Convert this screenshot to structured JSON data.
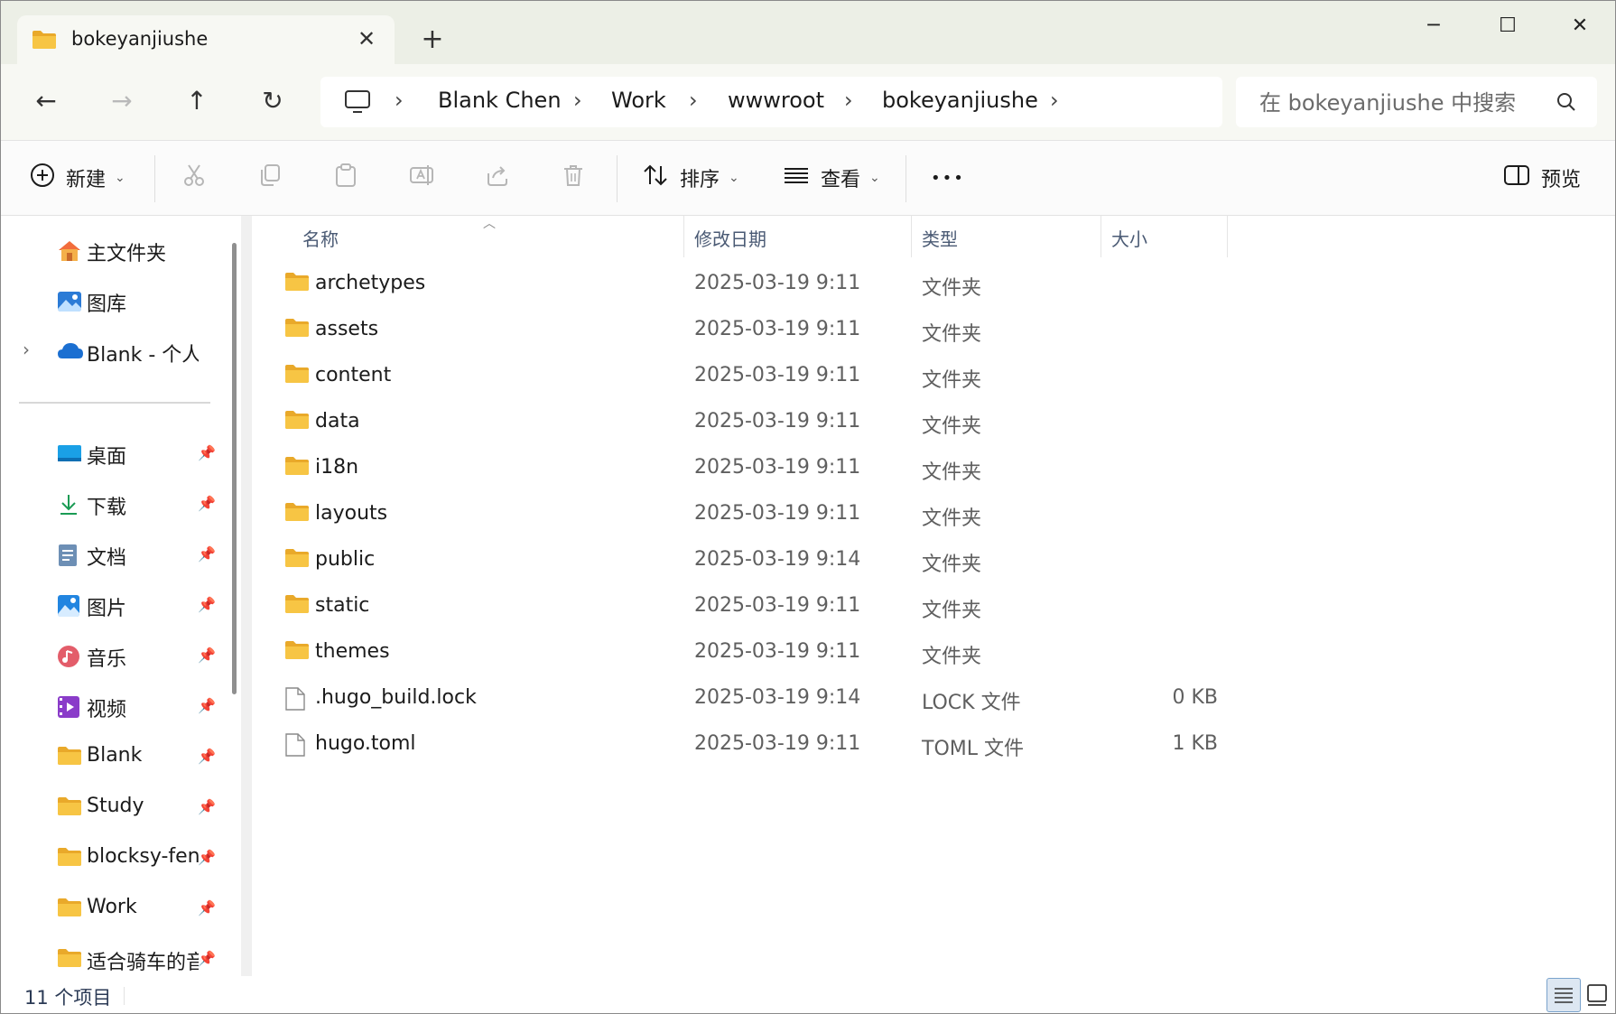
{
  "titlebar": {
    "tab_title": "bokeyanjiushe",
    "tab_close": "✕",
    "new_tab": "+",
    "minimize": "─",
    "maximize": "☐",
    "close": "✕"
  },
  "nav": {
    "back": "←",
    "forward": "→",
    "up": "↑",
    "refresh": "↻"
  },
  "address": {
    "separator": "›",
    "crumbs": [
      "Blank Chen",
      "Work",
      "wwwroot",
      "bokeyanjiushe"
    ]
  },
  "search": {
    "placeholder": "在 bokeyanjiushe 中搜索"
  },
  "commandbar": {
    "new_label": "新建",
    "sort_label": "排序",
    "view_label": "查看",
    "more_label": "•••",
    "preview_label": "预览"
  },
  "sidebar": {
    "top_items": [
      {
        "label": "主文件夹",
        "icon": "home-icon"
      },
      {
        "label": "图库",
        "icon": "gallery-icon"
      },
      {
        "label": "Blank - 个人",
        "icon": "onedrive-cloud-icon",
        "expand": "›"
      }
    ],
    "pinned_items": [
      {
        "label": "桌面",
        "icon": "desktop-icon"
      },
      {
        "label": "下载",
        "icon": "download-icon"
      },
      {
        "label": "文档",
        "icon": "documents-icon"
      },
      {
        "label": "图片",
        "icon": "pictures-icon"
      },
      {
        "label": "音乐",
        "icon": "music-icon"
      },
      {
        "label": "视频",
        "icon": "videos-icon"
      },
      {
        "label": "Blank",
        "icon": "folder-icon"
      },
      {
        "label": "Study",
        "icon": "folder-icon"
      },
      {
        "label": "blocksy-feng",
        "icon": "folder-icon"
      },
      {
        "label": "Work",
        "icon": "folder-icon"
      },
      {
        "label": "适合骑车的音",
        "icon": "folder-icon"
      }
    ]
  },
  "columns": {
    "name": "名称",
    "modified": "修改日期",
    "type": "类型",
    "size": "大小"
  },
  "files": [
    {
      "name": "archetypes",
      "date": "2025-03-19 9:11",
      "type": "文件夹",
      "size": "",
      "kind": "folder"
    },
    {
      "name": "assets",
      "date": "2025-03-19 9:11",
      "type": "文件夹",
      "size": "",
      "kind": "folder"
    },
    {
      "name": "content",
      "date": "2025-03-19 9:11",
      "type": "文件夹",
      "size": "",
      "kind": "folder"
    },
    {
      "name": "data",
      "date": "2025-03-19 9:11",
      "type": "文件夹",
      "size": "",
      "kind": "folder"
    },
    {
      "name": "i18n",
      "date": "2025-03-19 9:11",
      "type": "文件夹",
      "size": "",
      "kind": "folder"
    },
    {
      "name": "layouts",
      "date": "2025-03-19 9:11",
      "type": "文件夹",
      "size": "",
      "kind": "folder"
    },
    {
      "name": "public",
      "date": "2025-03-19 9:14",
      "type": "文件夹",
      "size": "",
      "kind": "folder"
    },
    {
      "name": "static",
      "date": "2025-03-19 9:11",
      "type": "文件夹",
      "size": "",
      "kind": "folder"
    },
    {
      "name": "themes",
      "date": "2025-03-19 9:11",
      "type": "文件夹",
      "size": "",
      "kind": "folder"
    },
    {
      "name": ".hugo_build.lock",
      "date": "2025-03-19 9:14",
      "type": "LOCK 文件",
      "size": "0 KB",
      "kind": "file"
    },
    {
      "name": "hugo.toml",
      "date": "2025-03-19 9:11",
      "type": "TOML 文件",
      "size": "1 KB",
      "kind": "file"
    }
  ],
  "status": {
    "item_count": "11 个项目"
  },
  "colors": {
    "folder": "#f7c544",
    "folder_tab": "#e9a92a",
    "accent": "#0067c0",
    "titlebar_bg": "#ecefe6"
  }
}
